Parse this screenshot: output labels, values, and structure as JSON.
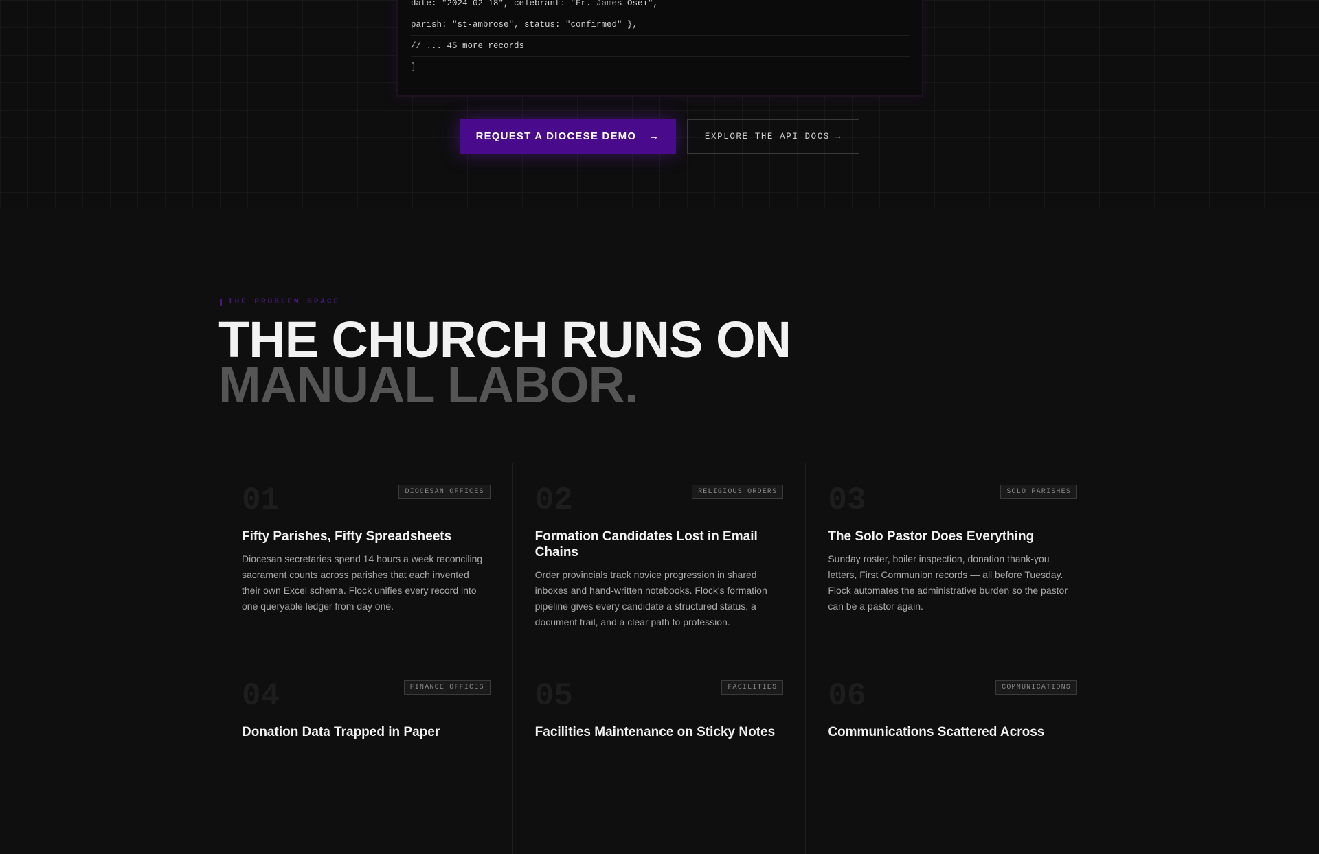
{
  "code": {
    "lines": [
      "date: \"2024-02-18\", celebrant: \"Fr. James Osei\",",
      "parish: \"st-ambrose\", status: \"confirmed\" },",
      "// ... 45 more records",
      "]"
    ]
  },
  "cta": {
    "primary_label": "REQUEST A DIOCESE DEMO",
    "primary_arrow": "→",
    "secondary_label": "EXPLORE THE API DOCS",
    "secondary_arrow": "→"
  },
  "problem": {
    "eyebrow": "THE PROBLEM SPACE",
    "headline_line1": "THE CHURCH RUNS ON",
    "headline_line2": "MANUAL LABOR.",
    "cards": [
      {
        "number": "01",
        "tag": "DIOCESAN OFFICES",
        "title": "Fifty Parishes, Fifty Spreadsheets",
        "body": "Diocesan secretaries spend 14 hours a week reconciling sacrament counts across parishes that each invented their own Excel schema. Flock unifies every record into one queryable ledger from day one."
      },
      {
        "number": "02",
        "tag": "RELIGIOUS ORDERS",
        "title": "Formation Candidates Lost in Email Chains",
        "body": "Order provincials track novice progression in shared inboxes and hand-written notebooks. Flock's formation pipeline gives every candidate a structured status, a document trail, and a clear path to profession."
      },
      {
        "number": "03",
        "tag": "SOLO PARISHES",
        "title": "The Solo Pastor Does Everything",
        "body": "Sunday roster, boiler inspection, donation thank-you letters, First Communion records — all before Tuesday. Flock automates the administrative burden so the pastor can be a pastor again."
      },
      {
        "number": "04",
        "tag": "FINANCE OFFICES",
        "title": "Donation Data Trapped in Paper",
        "body": ""
      },
      {
        "number": "05",
        "tag": "FACILITIES",
        "title": "Facilities Maintenance on Sticky Notes",
        "body": ""
      },
      {
        "number": "06",
        "tag": "COMMUNICATIONS",
        "title": "Communications Scattered Across",
        "body": ""
      }
    ]
  }
}
